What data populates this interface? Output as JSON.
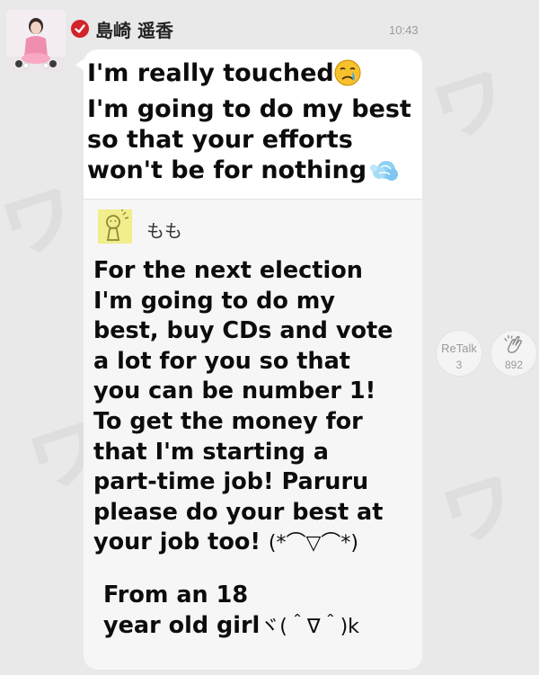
{
  "post": {
    "author_name": "島崎 遥香",
    "timestamp": "10:43",
    "message_lines": [
      "I'm really touched",
      "I'm going to do my best",
      "so that your efforts",
      "won't be for nothing"
    ],
    "emoji_icons": [
      "crying-face-icon",
      "dash-cloud-icon"
    ]
  },
  "quote": {
    "author_name": "もも",
    "lines": [
      "For the next election",
      "I'm going to do my",
      "best, buy CDs and vote",
      "a lot for you so that",
      "you can be number 1!",
      "To get the money for",
      "that I'm starting a",
      "part-time job! Paruru",
      "please do your best at",
      "your job too!"
    ],
    "kaomoji": "(*⌒▽⌒*)",
    "signature_lines": [
      "From an 18",
      "year old girl"
    ],
    "signature_kaomoji": "ヾ(＾∇＾)k"
  },
  "actions": {
    "retalk_label": "ReTalk",
    "retalk_count": "3",
    "clap_count": "892"
  },
  "colors": {
    "background": "#e9e9e9",
    "bubble": "#ffffff",
    "verified_badge": "#d2232a",
    "muted_text": "#9a9a9a"
  }
}
